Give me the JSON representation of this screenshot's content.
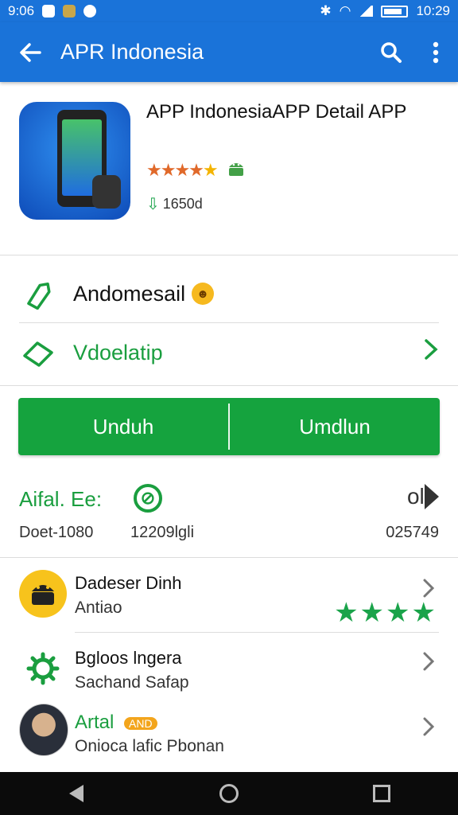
{
  "status_bar": {
    "time_left": "9:06",
    "time_right": "10:29"
  },
  "app_bar": {
    "title": "APR Indonesia"
  },
  "header": {
    "app_name": "APP IndonesiaAPP Detail APP",
    "downloads": "1650d"
  },
  "rows": [
    {
      "label": "Andomesail"
    },
    {
      "label": "Vdoelatip"
    }
  ],
  "install": {
    "left_label": "Unduh",
    "right_label": "Umdlun"
  },
  "stats": {
    "title": "Aifal. Ee:",
    "right_text": "oll",
    "values": [
      "Doet-1080",
      "12209lgli",
      "025749"
    ]
  },
  "list": [
    {
      "title": "Dadeser Dinh",
      "subtitle": "Antiao",
      "stars": 4
    },
    {
      "title": "Bgloos lngera",
      "subtitle": "Sachand Safap"
    },
    {
      "title": "Artal",
      "badge": "AND",
      "subtitle": "Onioca lafic Pbonan"
    }
  ],
  "colors": {
    "primary": "#1a73d9",
    "accent_green": "#15a33e",
    "star_orange": "#e0692a"
  }
}
